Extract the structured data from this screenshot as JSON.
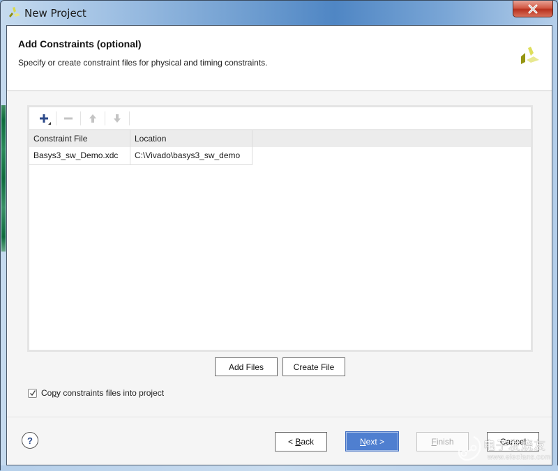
{
  "window": {
    "title": "New Project",
    "app_icon": "vivado-logo-icon",
    "close_icon": "close-icon"
  },
  "header": {
    "title": "Add Constraints (optional)",
    "subtitle": "Specify or create constraint files for physical and timing constraints.",
    "logo_icon": "xilinx-logo-icon"
  },
  "toolbar": {
    "buttons": [
      {
        "name": "add",
        "icon": "plus-icon",
        "enabled": true,
        "has_dropdown": true
      },
      {
        "name": "remove",
        "icon": "minus-icon",
        "enabled": false
      },
      {
        "name": "move-up",
        "icon": "arrow-up-icon",
        "enabled": false
      },
      {
        "name": "move-down",
        "icon": "arrow-down-icon",
        "enabled": false
      }
    ]
  },
  "table": {
    "columns": [
      "Constraint File",
      "Location"
    ],
    "rows": [
      [
        "Basys3_sw_Demo.xdc",
        "C:\\Vivado\\basys3_sw_demo"
      ]
    ]
  },
  "actions": {
    "add_files": "Add Files",
    "create_file": "Create File"
  },
  "copy_option": {
    "label_pre": "Co",
    "label_mnemonic": "p",
    "label_post": "y constraints files into project",
    "checked": true
  },
  "footer": {
    "help": "?",
    "back": {
      "prefix": "< ",
      "mnemonic": "B",
      "rest": "ack"
    },
    "next": {
      "mnemonic": "N",
      "rest": "ext >"
    },
    "finish": {
      "mnemonic": "F",
      "rest": "inish",
      "enabled": false
    },
    "cancel": "Cancel"
  },
  "watermark": {
    "text_cn": "电子发烧友",
    "url": "www.elecfans.com"
  },
  "colors": {
    "accent_next": "#4f7fd0",
    "close_red": "#c8402b",
    "logo_yellow": "#dede5a",
    "plus_blue": "#2c4a8a"
  }
}
